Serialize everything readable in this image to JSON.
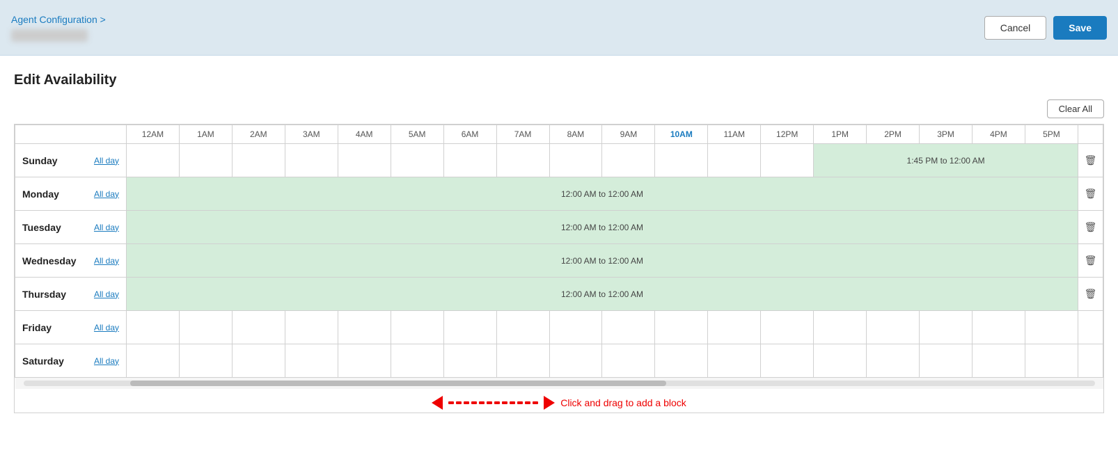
{
  "header": {
    "breadcrumb": "Agent Configuration >",
    "cancel_label": "Cancel",
    "save_label": "Save"
  },
  "page": {
    "title": "Edit Availability",
    "clear_all_label": "Clear All"
  },
  "time_headers": [
    "12AM",
    "1AM",
    "2AM",
    "3AM",
    "4AM",
    "5AM",
    "6AM",
    "7AM",
    "8AM",
    "9AM",
    "10AM",
    "11AM",
    "12PM",
    "1PM",
    "2PM",
    "3PM",
    "4PM",
    "5PM"
  ],
  "highlight_time": "10AM",
  "days": [
    {
      "name": "Sunday",
      "all_day_label": "All day",
      "has_block": true,
      "block_text": "1:45 PM to 12:00 AM",
      "block_start_col": 14,
      "full_row": false
    },
    {
      "name": "Monday",
      "all_day_label": "All day",
      "has_block": true,
      "block_text": "12:00 AM to 12:00 AM",
      "full_row": true
    },
    {
      "name": "Tuesday",
      "all_day_label": "All day",
      "has_block": true,
      "block_text": "12:00 AM to 12:00 AM",
      "full_row": true
    },
    {
      "name": "Wednesday",
      "all_day_label": "All day",
      "has_block": true,
      "block_text": "12:00 AM to 12:00 AM",
      "full_row": true
    },
    {
      "name": "Thursday",
      "all_day_label": "All day",
      "has_block": true,
      "block_text": "12:00 AM to 12:00 AM",
      "full_row": true
    },
    {
      "name": "Friday",
      "all_day_label": "All day",
      "has_block": false,
      "full_row": false
    },
    {
      "name": "Saturday",
      "all_day_label": "All day",
      "has_block": false,
      "full_row": false,
      "show_drag": true
    }
  ],
  "drag_hint": "Click and drag to add a block",
  "icons": {
    "delete": "🗑"
  }
}
